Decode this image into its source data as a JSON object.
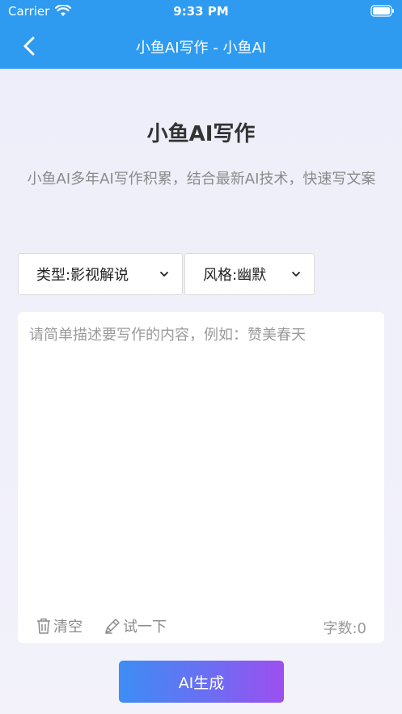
{
  "status": {
    "carrier": "Carrier",
    "time": "9:33 PM"
  },
  "nav": {
    "title": "小鱼AI写作 - 小鱼AI"
  },
  "page": {
    "heading": "小鱼AI写作",
    "description": "小鱼AI多年AI写作积累，结合最新AI技术，快速写文案"
  },
  "selects": {
    "type_label": "类型:影视解说",
    "style_label": "风格:幽默"
  },
  "input": {
    "placeholder": "请简单描述要写作的内容，例如：赞美春天",
    "value": ""
  },
  "tools": {
    "clear_label": "清空",
    "try_label": "试一下",
    "wordcount": "字数:0"
  },
  "action": {
    "generate_label": "AI生成"
  },
  "colors": {
    "header_bg": "#2e9bf0",
    "btn_start": "#3d8df4",
    "btn_end": "#9d4ff0"
  },
  "icons": [
    "back-chevron-icon",
    "wifi-icon",
    "battery-icon",
    "chevron-down-icon",
    "trash-icon",
    "pen-icon"
  ]
}
